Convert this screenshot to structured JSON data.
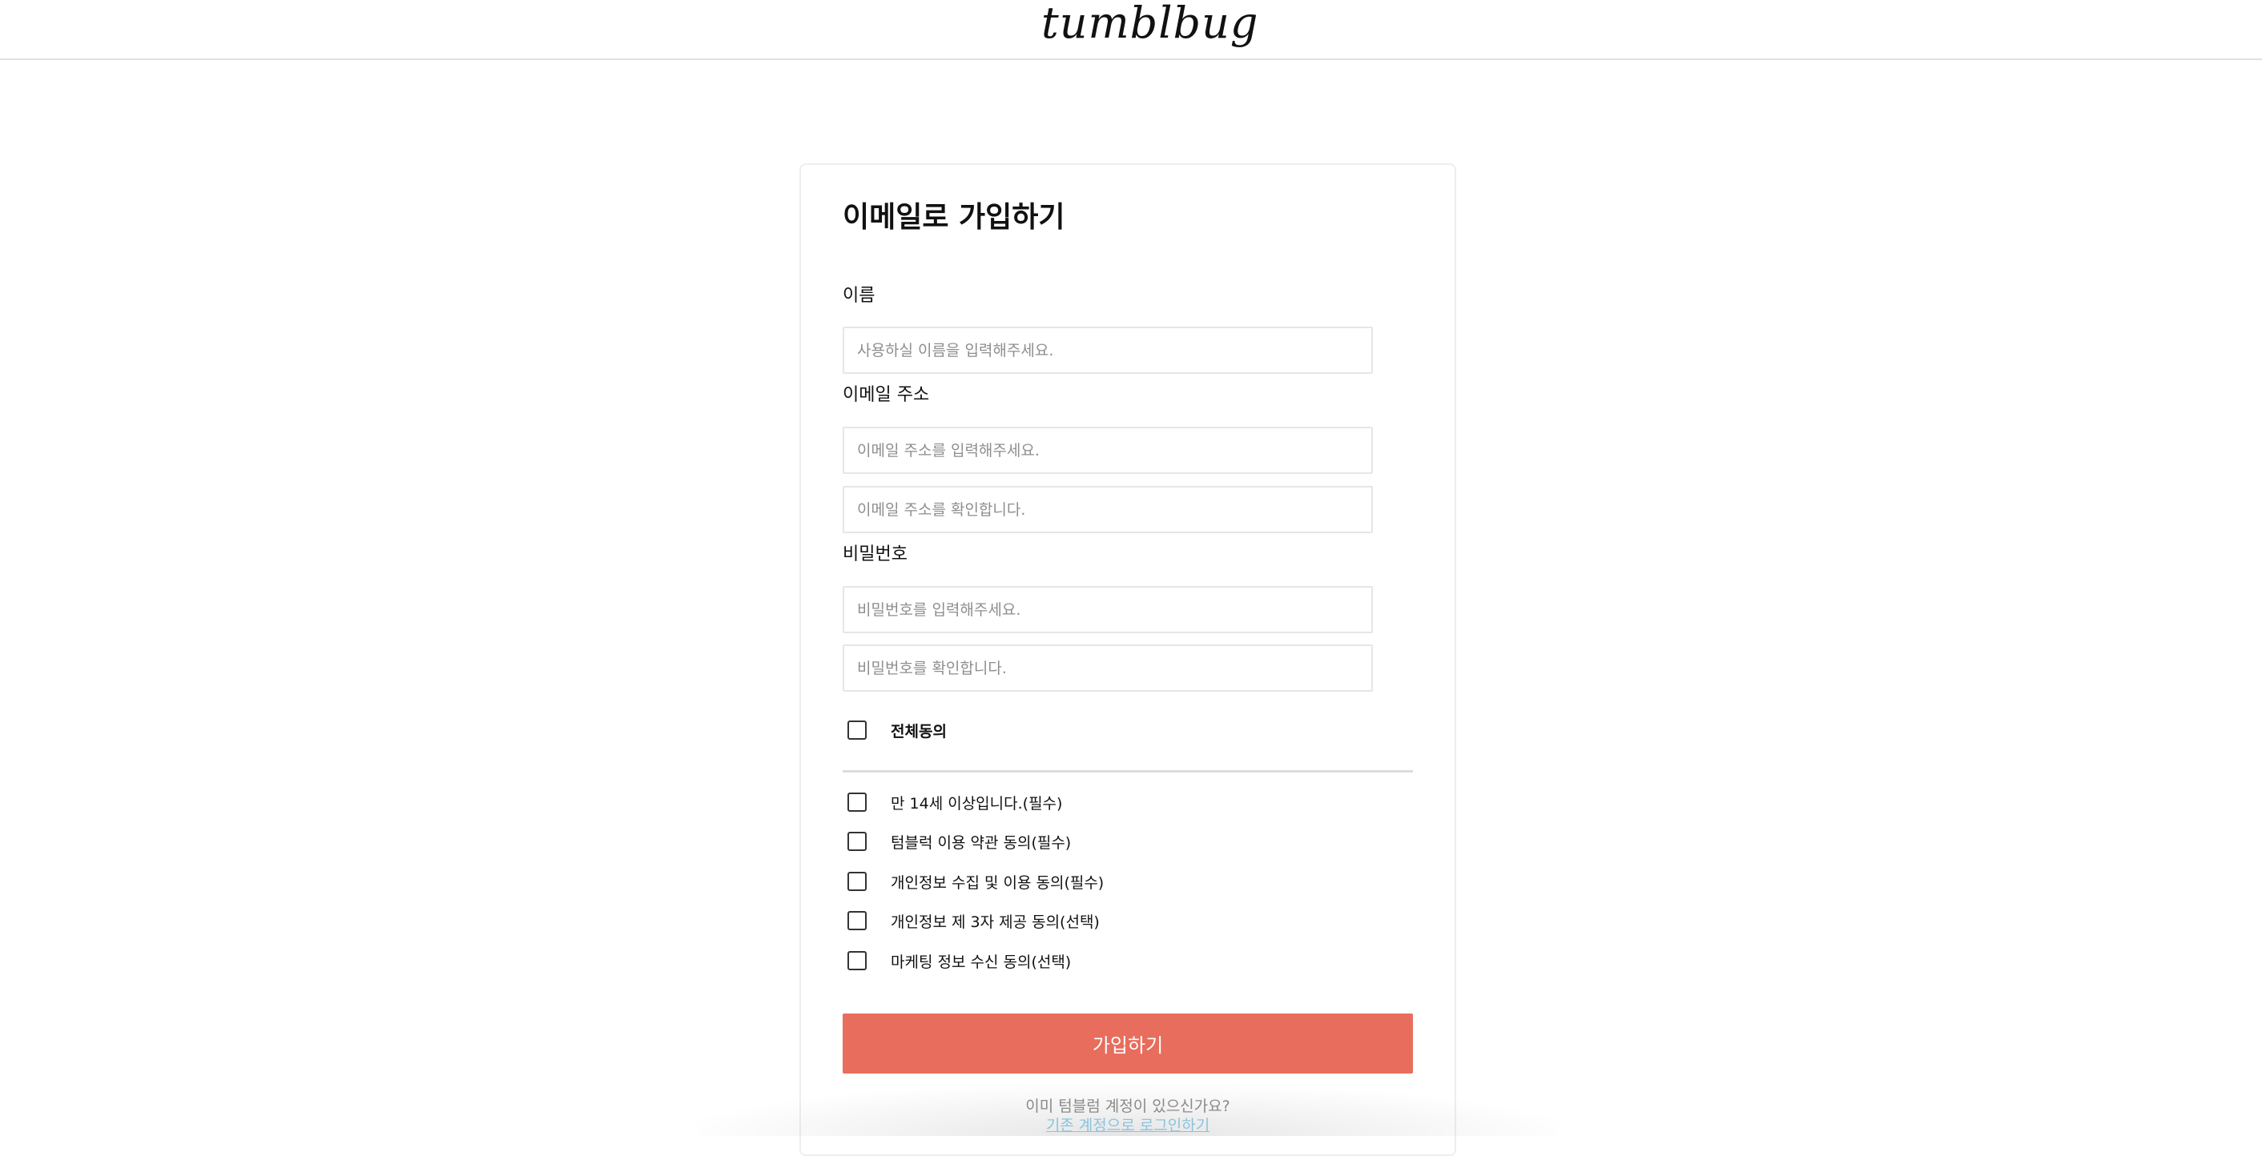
{
  "header": {
    "logo_text": "tumblbug"
  },
  "form": {
    "title": "이메일로 가입하기",
    "name_label": "이름",
    "name_placeholder": "사용하실 이름을 입력해주세요.",
    "email_label": "이메일 주소",
    "email_placeholder": "이메일 주소를 입력해주세요.",
    "email_confirm_placeholder": "이메일 주소를 확인합니다.",
    "password_label": "비밀번호",
    "password_placeholder": "비밀번호를 입력해주세요.",
    "password_confirm_placeholder": "비밀번호를 확인합니다."
  },
  "agreements": {
    "all": {
      "label": "전체동의",
      "checked": false
    },
    "items": [
      {
        "label": "만 14세 이상입니다.(필수)",
        "checked": false
      },
      {
        "label": "텀블럭 이용 약관 동의(필수)",
        "checked": false
      },
      {
        "label": "개인정보 수집 및 이용 동의(필수)",
        "checked": false
      },
      {
        "label": "개인정보 제 3자 제공 동의(선택)",
        "checked": false
      },
      {
        "label": "마케팅 정보 수신 동의(선택)",
        "checked": false
      }
    ]
  },
  "submit": {
    "label": "가입하기",
    "color": "#e86d5c"
  },
  "footer": {
    "existing_account_text": "이미 텀블럼 계정이 있으신가요?",
    "login_link": "기존 계정으로 로그인하기"
  }
}
